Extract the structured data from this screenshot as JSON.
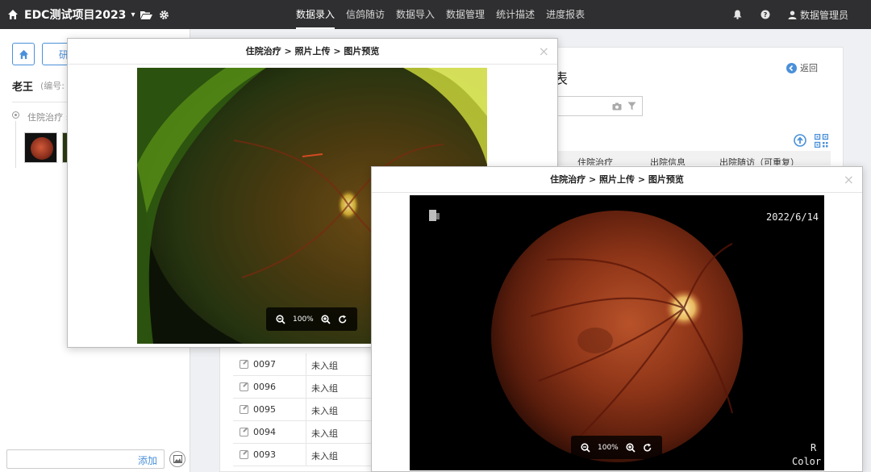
{
  "app": {
    "title": "EDC测试项目2023",
    "caret": "▾"
  },
  "nav": {
    "items": [
      {
        "label": "数据录入",
        "active": true
      },
      {
        "label": "信鸽随访"
      },
      {
        "label": "数据导入"
      },
      {
        "label": "数据管理"
      },
      {
        "label": "统计描述"
      },
      {
        "label": "进度报表"
      }
    ]
  },
  "user": {
    "name": "数据管理员"
  },
  "left": {
    "study_button": "研",
    "patient_name": "老王",
    "patient_code_label": "(编号:",
    "tree_label": "住院治疗 :",
    "add_link": "添加"
  },
  "main": {
    "title_tail": "表",
    "back_label": "返回",
    "columns": [
      "住院治疗",
      "出院信息",
      "出院随访（可重复）"
    ],
    "rows": [
      {
        "id": "0097",
        "status": "未入组"
      },
      {
        "id": "0096",
        "status": "未入组"
      },
      {
        "id": "0095",
        "status": "未入组"
      },
      {
        "id": "0094",
        "status": "未入组"
      },
      {
        "id": "0093",
        "status": "未入组"
      }
    ]
  },
  "modal1": {
    "title": "住院治疗 > 照片上传 > 图片预览",
    "close": "×",
    "zoom": "100%"
  },
  "modal2": {
    "title": "住院治疗 > 照片上传 > 图片预览",
    "close": "×",
    "zoom": "100%",
    "date_stamp": "2022/6/14",
    "eye_label": "R",
    "mode_label": "Color"
  },
  "colors": {
    "topbar": "#2f2f31",
    "accent": "#4a90d9"
  }
}
